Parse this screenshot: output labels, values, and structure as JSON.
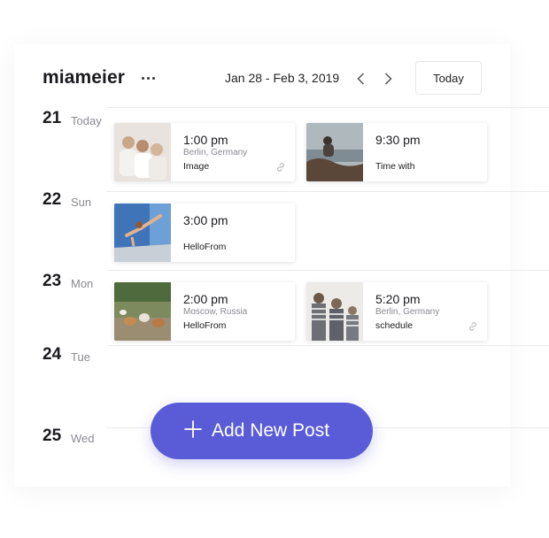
{
  "header": {
    "account_name": "miameier",
    "date_range": "Jan 28 - Feb 3, 2019",
    "today_label": "Today"
  },
  "days": [
    {
      "num": "21",
      "name": "Today"
    },
    {
      "num": "22",
      "name": "Sun"
    },
    {
      "num": "23",
      "name": "Mon"
    },
    {
      "num": "24",
      "name": "Tue"
    },
    {
      "num": "25",
      "name": "Wed"
    }
  ],
  "posts": [
    {
      "time": "1:00 pm",
      "location": "Berlin, Germany",
      "type": "Image",
      "linked": true,
      "icon": "women-group-photo"
    },
    {
      "time": "9:30 pm",
      "location": "",
      "type": "Time with",
      "linked": false,
      "icon": "sea-rocks-photo"
    },
    {
      "time": "3:00 pm",
      "location": "",
      "type": "HelloFrom",
      "linked": false,
      "icon": "yoga-photo"
    },
    {
      "time": "2:00 pm",
      "location": "Moscow, Russia",
      "type": "HelloFrom",
      "linked": false,
      "icon": "dogs-photo"
    },
    {
      "time": "5:20 pm",
      "location": "Berlin, Germany",
      "type": "schedule",
      "linked": true,
      "icon": "kids-photo"
    }
  ],
  "add_button": {
    "label": "Add New Post",
    "color": "#5a5bd7"
  },
  "colors": {
    "accent": "#5a5bd7",
    "muted_text": "#8a8a92"
  }
}
